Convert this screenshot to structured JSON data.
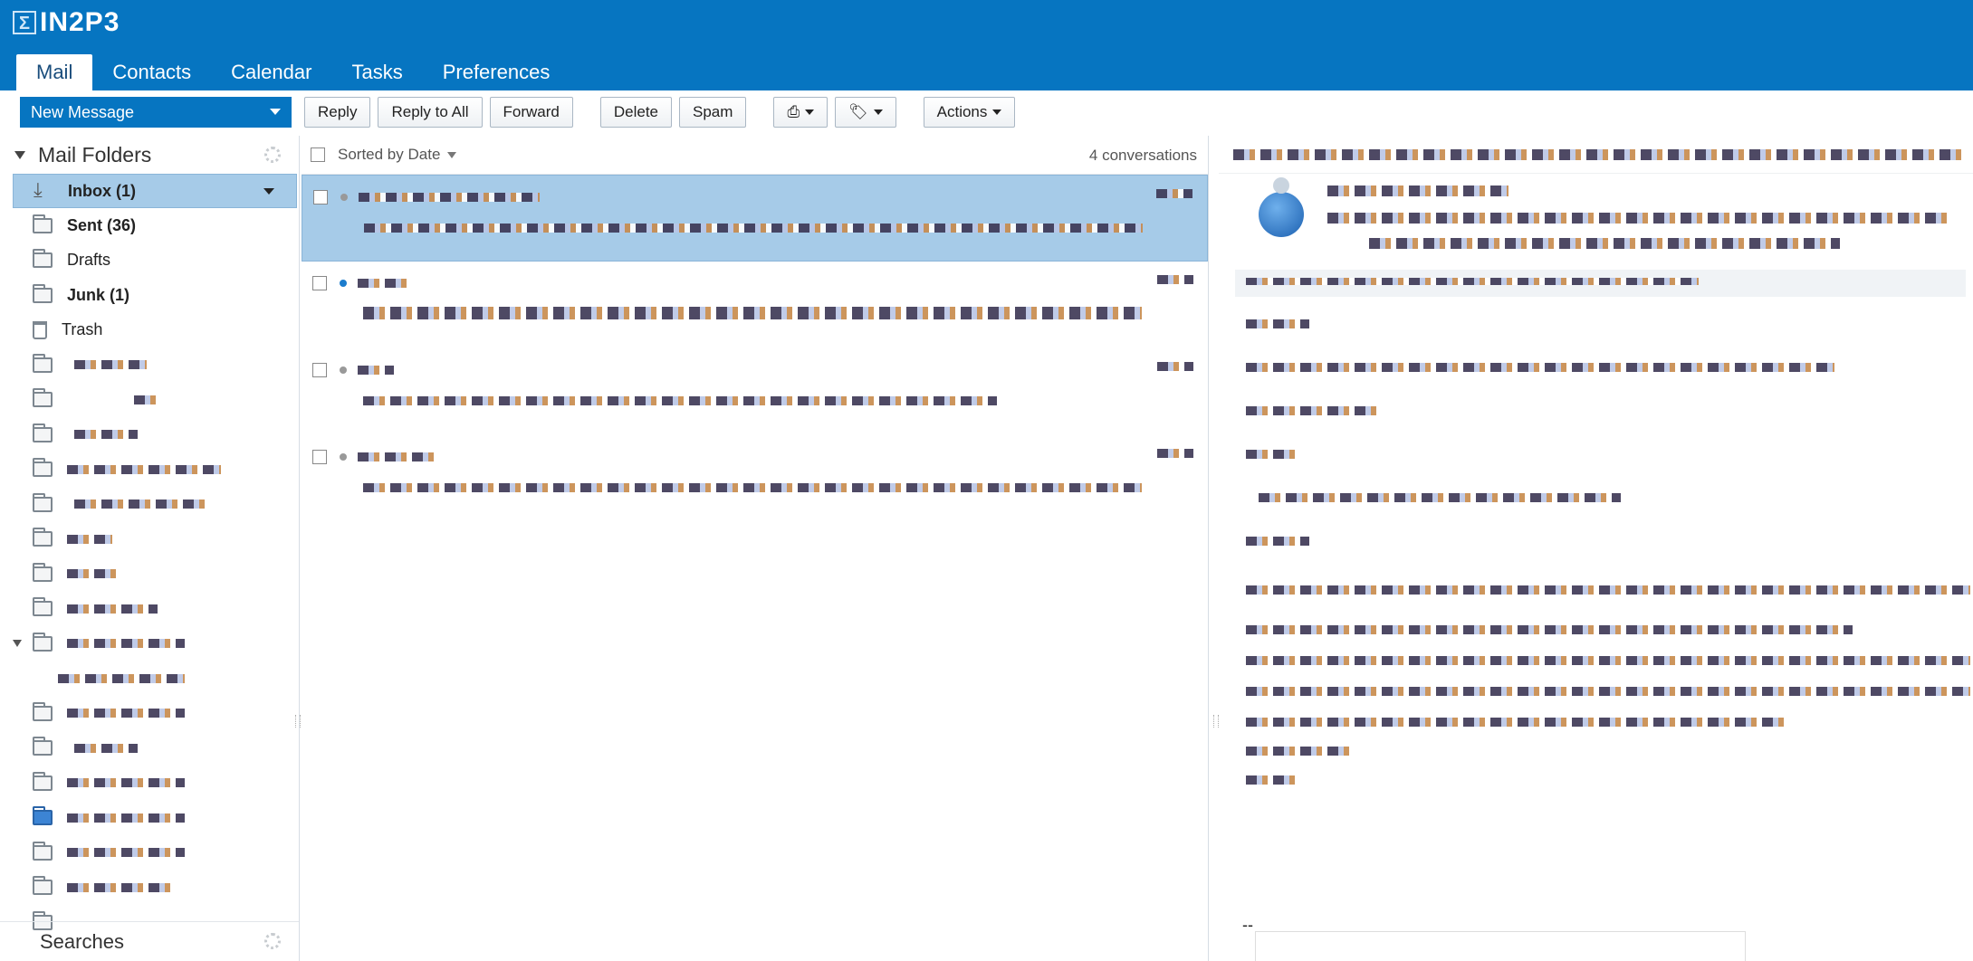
{
  "brand": {
    "logo_mark": "Σ",
    "name": "IN2P3"
  },
  "app_tabs": [
    "Mail",
    "Contacts",
    "Calendar",
    "Tasks",
    "Preferences"
  ],
  "active_tab": "Mail",
  "toolbar": {
    "new_message": "New Message",
    "reply": "Reply",
    "reply_all": "Reply to All",
    "forward": "Forward",
    "delete": "Delete",
    "spam": "Spam",
    "actions": "Actions"
  },
  "folders": {
    "header": "Mail Folders",
    "system": [
      {
        "name": "Inbox (1)",
        "icon": "inbox-icon",
        "bold": true,
        "selected": true
      },
      {
        "name": "Sent (36)",
        "icon": "sent-icon",
        "bold": true
      },
      {
        "name": "Drafts",
        "icon": "drafts-icon",
        "bold": false
      },
      {
        "name": "Junk (1)",
        "icon": "junk-icon",
        "bold": true
      },
      {
        "name": "Trash",
        "icon": "trash-icon",
        "bold": false
      }
    ],
    "searches": "Searches"
  },
  "message_list": {
    "sort_label": "Sorted by Date",
    "count": "4 conversations"
  },
  "reading_pane": {
    "separator": "--"
  },
  "colors": {
    "header_bg": "#0675c1",
    "selection_bg": "#a6cbe8",
    "unread_dot": "#1b7ccd"
  }
}
